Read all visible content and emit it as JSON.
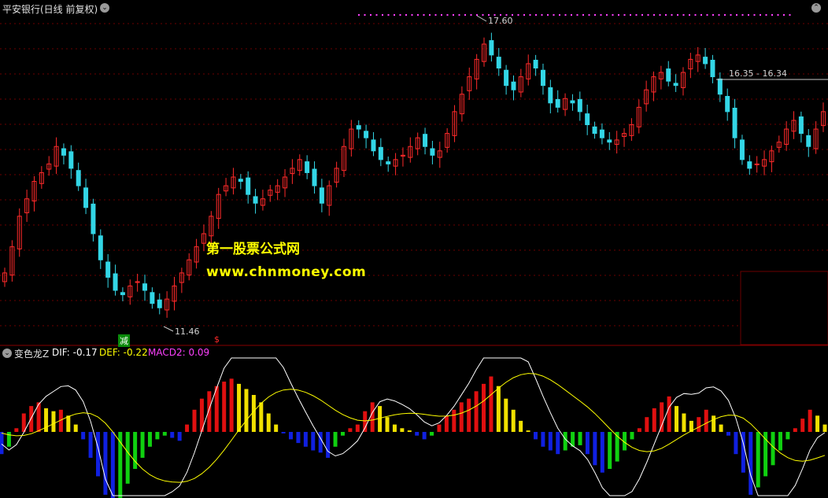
{
  "header": {
    "title": "平安银行(日线 前复权)"
  },
  "indicator": {
    "name": "变色龙Z",
    "dif_label": "DIF: -0.17",
    "def_label": "DEF: -0.22",
    "macd2_label": "MACD2: 0.09"
  },
  "annotations": {
    "high": "17.60",
    "low": "11.46",
    "range": "16.35 - 16.34",
    "sell_mark": "减",
    "buy_mark": "$"
  },
  "watermark": {
    "line1": "第一股票公式网",
    "line2": "www.chnmoney.com"
  },
  "colors": {
    "up": "#ff2a2a",
    "down": "#33d6e6",
    "dif": "#ffffff",
    "def": "#ffff00",
    "macd2_label": "#ff40ff",
    "macd_red": "#e01010",
    "macd_yellow": "#f0e000",
    "macd_blue": "#1020e0",
    "macd_green": "#10d010",
    "grid": "#6b0000"
  },
  "chart_data": [
    {
      "type": "candlestick",
      "title": "平安银行(日线 前复权)",
      "high": 17.6,
      "low": 11.46,
      "ylim": [
        10.8,
        18.2
      ],
      "closes": [
        12.3,
        12.9,
        13.6,
        14.0,
        14.4,
        14.6,
        14.8,
        15.2,
        15.0,
        14.7,
        14.3,
        13.8,
        13.2,
        12.6,
        12.2,
        11.9,
        11.8,
        12.0,
        12.1,
        11.9,
        11.6,
        11.5,
        11.7,
        12.0,
        12.3,
        12.6,
        12.9,
        13.2,
        13.6,
        14.1,
        14.3,
        14.5,
        14.4,
        14.1,
        13.9,
        14.0,
        14.2,
        14.3,
        14.5,
        14.7,
        14.9,
        14.6,
        14.3,
        13.9,
        14.3,
        14.7,
        15.2,
        15.6,
        15.6,
        15.4,
        15.1,
        14.9,
        14.8,
        14.9,
        15.0,
        15.2,
        15.4,
        15.2,
        15.0,
        15.1,
        15.5,
        16.0,
        16.4,
        16.8,
        17.2,
        17.55,
        17.3,
        17.0,
        16.6,
        16.5,
        16.8,
        17.1,
        17.0,
        16.6,
        16.2,
        16.1,
        16.3,
        16.2,
        16.0,
        15.7,
        15.5,
        15.4,
        15.3,
        15.35,
        15.5,
        15.7,
        16.1,
        16.5,
        16.8,
        16.9,
        16.7,
        16.6,
        16.9,
        17.2,
        17.3,
        17.1,
        16.8,
        16.4,
        16.0,
        15.4,
        14.9,
        14.7,
        14.8,
        14.9,
        15.1,
        15.3,
        15.6,
        15.8,
        15.5,
        15.2,
        15.6,
        16.0
      ]
    },
    {
      "type": "bar",
      "title": "变色龙Z",
      "series": [
        {
          "name": "DIF",
          "last": -0.17
        },
        {
          "name": "DEF",
          "last": -0.22
        },
        {
          "name": "MACD2",
          "last": 0.09
        }
      ],
      "ylim": [
        -1.0,
        1.0
      ],
      "values": [
        -0.3,
        -0.2,
        0.05,
        0.25,
        0.35,
        0.4,
        0.32,
        0.28,
        0.3,
        0.22,
        0.1,
        -0.1,
        -0.35,
        -0.6,
        -0.85,
        -1.0,
        -0.9,
        -0.7,
        -0.5,
        -0.35,
        -0.2,
        -0.1,
        -0.05,
        -0.08,
        -0.12,
        0.1,
        0.3,
        0.45,
        0.55,
        0.62,
        0.68,
        0.72,
        0.65,
        0.58,
        0.5,
        0.4,
        0.25,
        0.1,
        -0.02,
        -0.1,
        -0.15,
        -0.2,
        -0.25,
        -0.28,
        -0.35,
        -0.2,
        -0.05,
        0.05,
        0.1,
        0.28,
        0.4,
        0.35,
        0.2,
        0.1,
        0.05,
        0.02,
        -0.05,
        -0.1,
        -0.05,
        0.1,
        0.22,
        0.3,
        0.4,
        0.45,
        0.55,
        0.65,
        0.75,
        0.62,
        0.45,
        0.3,
        0.15,
        0.02,
        -0.1,
        -0.2,
        -0.25,
        -0.3,
        -0.25,
        -0.2,
        -0.18,
        -0.3,
        -0.45,
        -0.55,
        -0.5,
        -0.4,
        -0.25,
        -0.1,
        0.05,
        0.2,
        0.32,
        0.4,
        0.48,
        0.35,
        0.25,
        0.15,
        0.2,
        0.3,
        0.22,
        0.1,
        -0.05,
        -0.3,
        -0.55,
        -0.85,
        -0.75,
        -0.6,
        -0.45,
        -0.25,
        -0.1,
        0.05,
        0.18,
        0.3,
        0.22,
        0.1
      ]
    }
  ]
}
